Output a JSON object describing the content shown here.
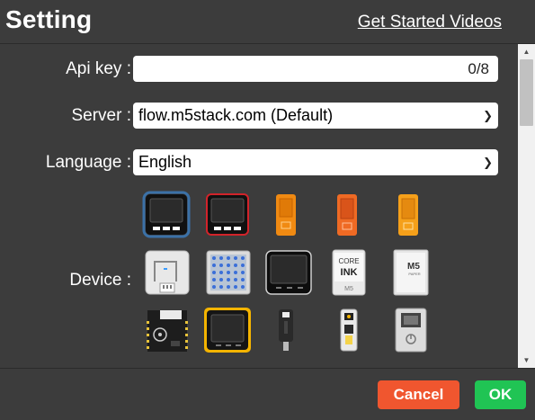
{
  "header": {
    "title": "Setting",
    "videos_link": "Get Started Videos"
  },
  "form": {
    "api_key": {
      "label": "Api key :",
      "value": "",
      "counter": "0/8"
    },
    "server": {
      "label": "Server :",
      "selected": "flow.m5stack.com (Default)"
    },
    "language": {
      "label": "Language :",
      "selected": "English"
    },
    "device": {
      "label": "Device :"
    }
  },
  "devices": {
    "rows": [
      [
        "m5stack-basic-icon",
        "m5stack-gray-icon",
        "m5stickc-icon",
        "m5stickc-plus-icon",
        "m5stickc-plus2-icon"
      ],
      [
        "atom-lite-icon",
        "atom-matrix-icon",
        "core2-icon",
        "coreink-icon",
        "m5paper-icon"
      ],
      [
        "stamp-pico-icon",
        "core2-aws-icon",
        "atom-s3-icon",
        "atom-echo-icon",
        "station-icon"
      ]
    ],
    "coreink_text": [
      "CORE",
      "INK",
      "M5"
    ],
    "m5paper_text": [
      "M5",
      "PAPER"
    ]
  },
  "footer": {
    "cancel_label": "Cancel",
    "ok_label": "OK"
  },
  "colors": {
    "background": "#3c3c3c",
    "cancel": "#f0562f",
    "ok": "#20c454",
    "selected_glow": "#4aa8ff"
  }
}
